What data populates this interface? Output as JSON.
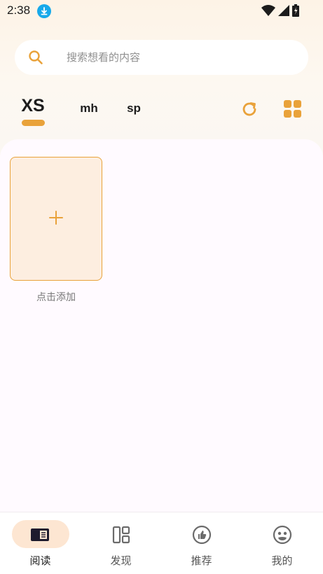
{
  "status_bar": {
    "time": "2:38",
    "download_icon": "download-icon",
    "wifi_icon": "wifi-icon",
    "signal_icon": "signal-icon",
    "battery_icon": "battery-charging-icon"
  },
  "search": {
    "placeholder": "搜索想看的内容",
    "value": ""
  },
  "tabs": [
    {
      "label": "XS",
      "active": true
    },
    {
      "label": "mh",
      "active": false
    },
    {
      "label": "sp",
      "active": false
    }
  ],
  "toolbar": {
    "refresh_icon": "refresh-icon",
    "layout_icon": "grid-icon"
  },
  "shelf": {
    "add_label": "点击添加",
    "add_symbol": "+"
  },
  "bottom_nav": [
    {
      "label": "阅读",
      "icon": "book-icon",
      "active": true
    },
    {
      "label": "发现",
      "icon": "discover-icon",
      "active": false
    },
    {
      "label": "推荐",
      "icon": "recommend-icon",
      "active": false
    },
    {
      "label": "我的",
      "icon": "profile-icon",
      "active": false
    }
  ],
  "colors": {
    "accent": "#e9a23a",
    "card_fill": "#fdeee0",
    "nav_pill": "#fde6d2"
  }
}
